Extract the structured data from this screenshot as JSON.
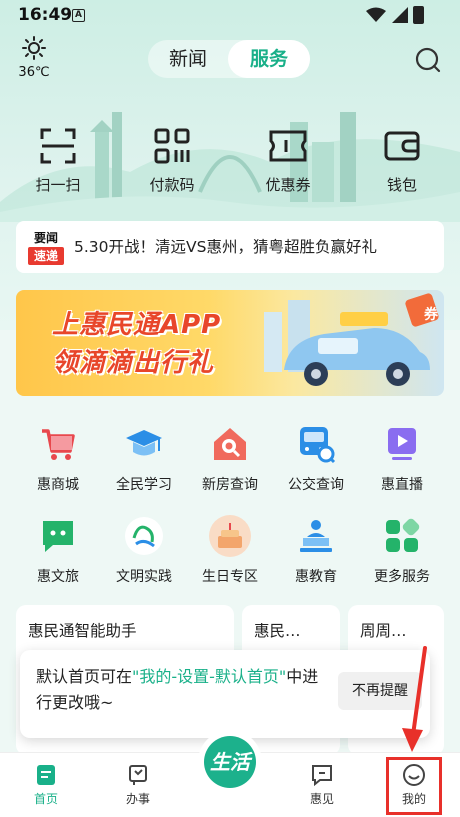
{
  "status_bar": {
    "time": "16:49",
    "notification_glyph": "A"
  },
  "weather": {
    "icon": "sun-icon",
    "temperature": "36℃"
  },
  "header_tabs": [
    {
      "label": "新闻",
      "active": false
    },
    {
      "label": "服务",
      "active": true
    }
  ],
  "quick_actions": [
    {
      "label": "扫一扫",
      "icon": "scan-icon"
    },
    {
      "label": "付款码",
      "icon": "qrcode-icon"
    },
    {
      "label": "优惠券",
      "icon": "coupon-icon"
    },
    {
      "label": "钱包",
      "icon": "wallet-icon"
    }
  ],
  "news": {
    "badge_top": "要闻",
    "badge_bottom": "速递",
    "text": "5.30开战！清远VS惠州，猜粤超胜负赢好礼"
  },
  "banner": {
    "line1": "上惠民通APP",
    "line2": "领滴滴出行礼",
    "tag": "券"
  },
  "services": [
    {
      "label": "惠商城",
      "icon": "cart-icon"
    },
    {
      "label": "全民学习",
      "icon": "graduation-cap-icon"
    },
    {
      "label": "新房查询",
      "icon": "house-search-icon"
    },
    {
      "label": "公交查询",
      "icon": "bus-search-icon"
    },
    {
      "label": "惠直播",
      "icon": "live-play-icon"
    },
    {
      "label": "惠文旅",
      "icon": "chat-bubble-icon"
    },
    {
      "label": "文明实践",
      "icon": "civilization-logo-icon"
    },
    {
      "label": "生日专区",
      "icon": "birthday-cake-icon"
    },
    {
      "label": "惠教育",
      "icon": "teacher-podium-icon"
    },
    {
      "label": "更多服务",
      "icon": "more-grid-icon"
    }
  ],
  "cards": [
    {
      "title": "惠民通智能助手"
    },
    {
      "title": "惠民…"
    },
    {
      "title": "周周…"
    }
  ],
  "toast": {
    "before": "默认首页可在",
    "highlight": "\"我的-设置-默认首页\"",
    "after": "中进行更改哦~",
    "dismiss_label": "不再提醒"
  },
  "bottom_nav": [
    {
      "label": "首页",
      "icon": "home-doc-icon",
      "active": true
    },
    {
      "label": "办事",
      "icon": "flag-icon",
      "active": false
    },
    {
      "label": "生活",
      "icon": "life-icon",
      "active": false
    },
    {
      "label": "惠见",
      "icon": "message-icon",
      "active": false
    },
    {
      "label": "我的",
      "icon": "smiley-icon",
      "active": false
    }
  ],
  "colors": {
    "accent": "#19b089",
    "news_badge": "#e83a30",
    "highlight_box": "#e8302a"
  }
}
